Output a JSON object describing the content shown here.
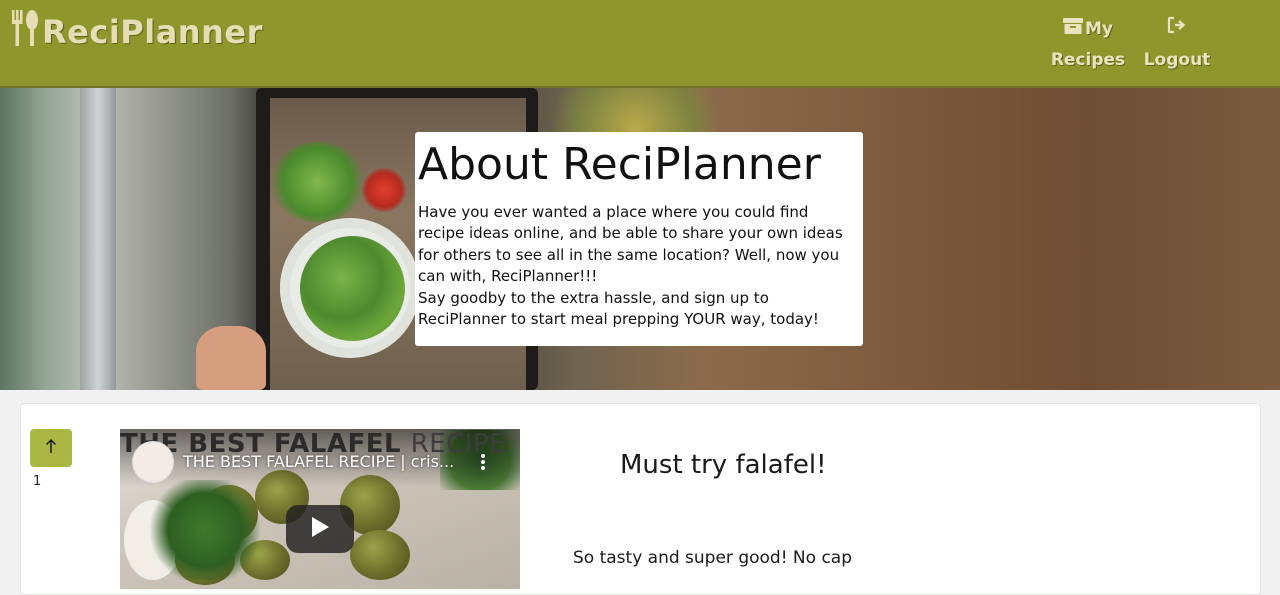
{
  "navbar": {
    "brand": "ReciPlanner",
    "my_recipes_top": "My",
    "my_recipes_bottom": "Recipes",
    "logout": "Logout",
    "background_color": "#8e962c",
    "text_color": "#ece4c0"
  },
  "hero": {
    "title": "About ReciPlanner",
    "paragraph_1": "Have you ever wanted a place where you could find recipe ideas online, and be able to share your own ideas for others to see all in the same location? Well, now you can with, ReciPlanner!!!",
    "paragraph_2": "Say goodby to the extra hassle, and sign up to ReciPlanner to start meal prepping YOUR way, today!"
  },
  "post": {
    "upvote_icon": "arrow-up-icon",
    "upvote_count": "1",
    "video": {
      "background_title_bold": "THE BEST FALAFEL",
      "background_title_thin": "RECIPE",
      "title": "THE BEST FALAFEL RECIPE | cris...",
      "play_icon": "play-icon",
      "menu_icon": "kebab-menu-icon"
    },
    "title": "Must try falafel!",
    "body": "So tasty and super good! No cap",
    "accent_color": "#aab744"
  }
}
